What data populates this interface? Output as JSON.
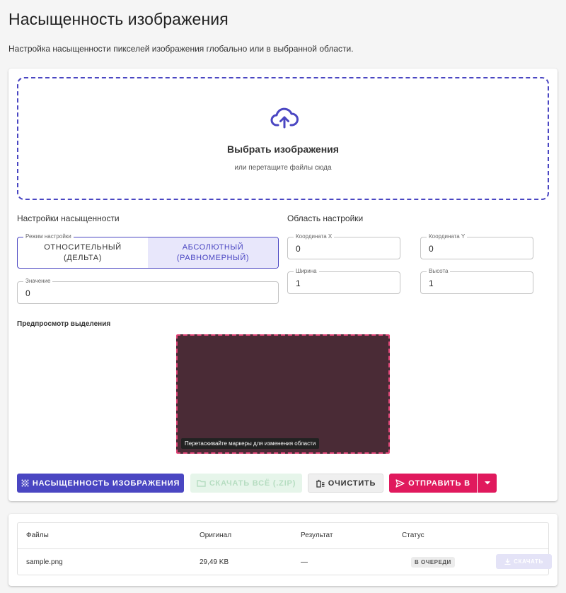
{
  "page": {
    "title": "Насыщенность изображения",
    "description": "Настройка насыщенности пикселей изображения глобально или в выбранной области."
  },
  "dropzone": {
    "title": "Выбрать изображения",
    "subtitle": "или перетащите файлы сюда",
    "icon": "cloud-upload-icon"
  },
  "saturation": {
    "section_title": "Настройки насыщенности",
    "mode_legend": "Режим настройки",
    "modes": [
      {
        "label": "ОТНОСИТЕЛЬНЫЙ\n(ДЕЛЬТА)",
        "selected": false
      },
      {
        "label": "АБСОЛЮТНЫЙ\n(РАВНОМЕРНЫЙ)",
        "selected": true
      }
    ],
    "value_legend": "Значение",
    "value": "0"
  },
  "region": {
    "section_title": "Область настройки",
    "x_legend": "Координата X",
    "x": "0",
    "y_legend": "Координата Y",
    "y": "0",
    "width_legend": "Ширина",
    "width": "1",
    "height_legend": "Высота",
    "height": "1"
  },
  "preview": {
    "label": "Предпросмотр выделения",
    "hint": "Перетаскивайте маркеры для изменения области"
  },
  "actions": {
    "apply": "НАСЫЩЕННОСТЬ ИЗОБРАЖЕНИЯ",
    "download_all": "СКАЧАТЬ ВСЁ (.ZIP)",
    "clear": "ОЧИСТИТЬ",
    "send_to": "ОТПРАВИТЬ В"
  },
  "files": {
    "headers": [
      "Файлы",
      "Оригинал",
      "Результат",
      "Статус"
    ],
    "rows": [
      {
        "name": "sample.png",
        "original": "29,49 KB",
        "result": "—",
        "status": "В ОЧЕРЕДИ",
        "download": "СКАЧАТЬ"
      }
    ]
  },
  "colors": {
    "accent": "#4a46c2",
    "send": "#e0195d",
    "preview_fill": "#4a2b36",
    "preview_border": "#e24679"
  }
}
